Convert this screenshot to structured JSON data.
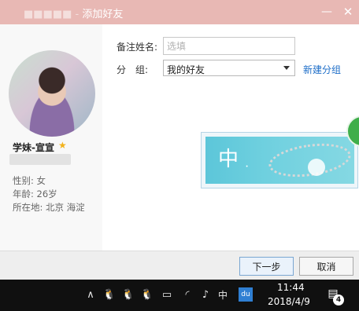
{
  "window": {
    "title_suffix": "添加好友",
    "title_prefix_blurred": "■■■■■ - ",
    "minimize_glyph": "—",
    "close_glyph": "✕"
  },
  "profile": {
    "name": "学妹-宣宣",
    "gender": "性别: 女",
    "age": "年龄: 26岁",
    "location": "所在地: 北京  海淀"
  },
  "form": {
    "remark_label": "备注姓名:",
    "remark_placeholder": "选填",
    "group_label": "分　组:",
    "group_value": "我的好友",
    "new_group_link": "新建分组"
  },
  "ad": {
    "char": "中",
    "swirl": "ॱ"
  },
  "buttons": {
    "next": "下一步",
    "cancel": "取消"
  },
  "taskbar": {
    "chevron": "∧",
    "qq_icon": "🐧",
    "battery": "▭",
    "wifi": "◜",
    "volume": "♪",
    "ime": "中",
    "baidu": "du",
    "time": "11:44",
    "date": "2018/4/9",
    "notify_badge": "4"
  },
  "colors": {
    "titlebar": "#e8b8b4",
    "link": "#1e6ec8",
    "star": "#f2b21b"
  }
}
